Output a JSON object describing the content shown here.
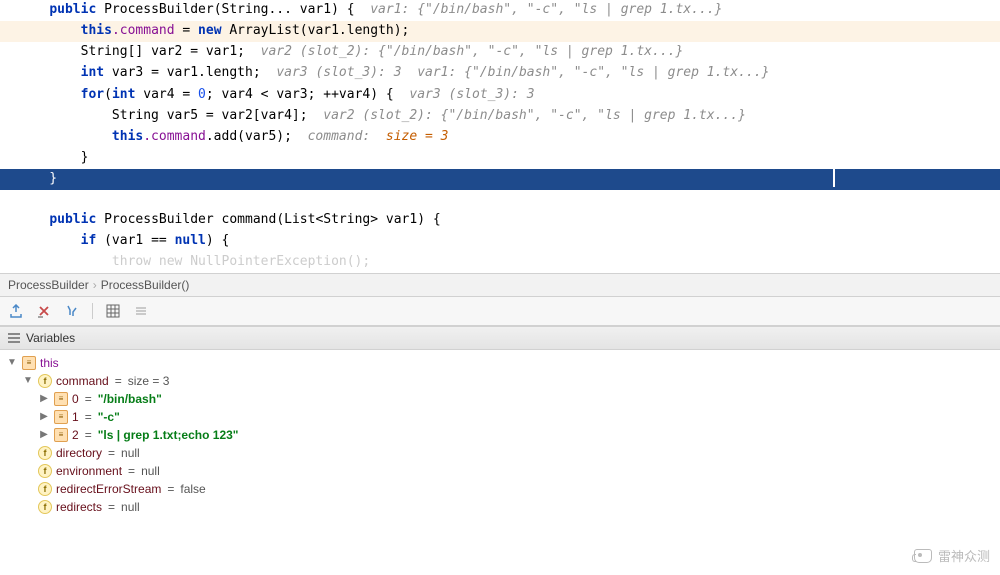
{
  "code": {
    "l1": {
      "kw1": "public",
      "type": "ProcessBuilder",
      "sig": "(String... var1) {",
      "hint": "var1: {\"/bin/bash\", \"-c\", \"ls | grep 1.tx...}"
    },
    "l2": {
      "this": "this",
      "field": ".command",
      "eq": " = ",
      "kw": "new",
      "rest": " ArrayList(var1.length);"
    },
    "l3": {
      "decl": "String[] var2 = var1;",
      "hint": "var2 (slot_2): {\"/bin/bash\", \"-c\", \"ls | grep 1.tx...}"
    },
    "l4": {
      "kw": "int",
      "rest": " var3 = var1.length;",
      "hint": "var3 (slot_3): 3  var1: {\"/bin/bash\", \"-c\", \"ls | grep 1.tx...}"
    },
    "l5": "",
    "l6": {
      "kw1": "for",
      "p": "(",
      "kw2": "int",
      "rest": " var4 = ",
      "n0": "0",
      "mid": "; var4 < var3; ++var4) {",
      "hint": "var3 (slot_3): 3"
    },
    "l7": {
      "decl": "String var5 = var2[var4];",
      "hint": "var2 (slot_2): {\"/bin/bash\", \"-c\", \"ls | grep 1.tx...}"
    },
    "l8": {
      "this": "this",
      "field": ".command",
      "rest": ".add(var5);",
      "hintlabel": "command:  ",
      "hintval": "size = 3"
    },
    "l9": "        }",
    "l10": "    }",
    "l12": {
      "kw": "public",
      "type": " ProcessBuilder ",
      "name": "command",
      "sig": "(List<String> var1) {"
    },
    "l13": {
      "kw1": "if",
      "p": " (var1 == ",
      "kw2": "null",
      "rest": ") {"
    },
    "l14": {
      "t": "            ",
      "faded": "throw new NullPointerException();"
    }
  },
  "breadcrumb": {
    "a": "ProcessBuilder",
    "b": "ProcessBuilder()"
  },
  "section": {
    "variables": "Variables"
  },
  "vars": {
    "this": "this",
    "command": {
      "name": "command",
      "val": " size = 3"
    },
    "items": [
      {
        "idx": "0",
        "val": "\"/bin/bash\""
      },
      {
        "idx": "1",
        "val": "\"-c\""
      },
      {
        "idx": "2",
        "val": "\"ls | grep 1.txt;echo 123\""
      }
    ],
    "directory": {
      "name": "directory",
      "val": "null"
    },
    "environment": {
      "name": "environment",
      "val": "null"
    },
    "redirectErrorStream": {
      "name": "redirectErrorStream",
      "val": "false"
    },
    "redirects": {
      "name": "redirects",
      "val": "null"
    }
  },
  "watermark": "雷神众测"
}
